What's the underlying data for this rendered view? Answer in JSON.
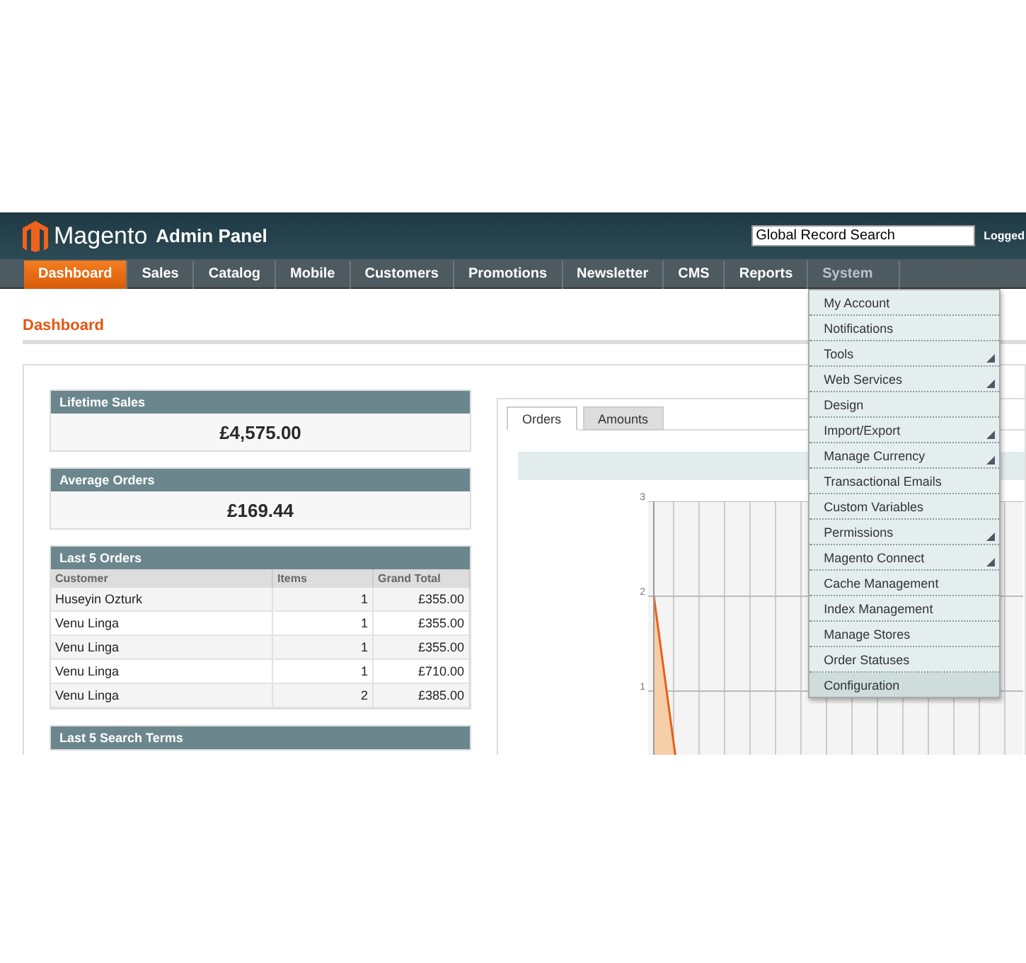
{
  "header": {
    "logo": "Magento",
    "subtitle": "Admin Panel",
    "search": {
      "value": "Global Record Search"
    },
    "user": "Logged"
  },
  "nav": [
    {
      "label": "Dashboard",
      "selected": true,
      "open": false
    },
    {
      "label": "Sales",
      "selected": false,
      "open": false
    },
    {
      "label": "Catalog",
      "selected": false,
      "open": false
    },
    {
      "label": "Mobile",
      "selected": false,
      "open": false
    },
    {
      "label": "Customers",
      "selected": false,
      "open": false
    },
    {
      "label": "Promotions",
      "selected": false,
      "open": false
    },
    {
      "label": "Newsletter",
      "selected": false,
      "open": false
    },
    {
      "label": "CMS",
      "selected": false,
      "open": false
    },
    {
      "label": "Reports",
      "selected": false,
      "open": false
    },
    {
      "label": "System",
      "selected": false,
      "open": true
    }
  ],
  "system_menu": [
    {
      "label": "My Account",
      "has_children": false,
      "selected": false
    },
    {
      "label": "Notifications",
      "has_children": false,
      "selected": false
    },
    {
      "label": "Tools",
      "has_children": true,
      "selected": false
    },
    {
      "label": "Web Services",
      "has_children": true,
      "selected": false
    },
    {
      "label": "Design",
      "has_children": false,
      "selected": false
    },
    {
      "label": "Import/Export",
      "has_children": true,
      "selected": false
    },
    {
      "label": "Manage Currency",
      "has_children": true,
      "selected": false
    },
    {
      "label": "Transactional Emails",
      "has_children": false,
      "selected": false
    },
    {
      "label": "Custom Variables",
      "has_children": false,
      "selected": false
    },
    {
      "label": "Permissions",
      "has_children": true,
      "selected": false
    },
    {
      "label": "Magento Connect",
      "has_children": true,
      "selected": false
    },
    {
      "label": "Cache Management",
      "has_children": false,
      "selected": false
    },
    {
      "label": "Index Management",
      "has_children": false,
      "selected": false
    },
    {
      "label": "Manage Stores",
      "has_children": false,
      "selected": false
    },
    {
      "label": "Order Statuses",
      "has_children": false,
      "selected": false
    },
    {
      "label": "Configuration",
      "has_children": false,
      "selected": true
    }
  ],
  "page_title": "Dashboard",
  "lifetime_sales": {
    "title": "Lifetime Sales",
    "value": "£4,575.00"
  },
  "average_orders": {
    "title": "Average Orders",
    "value": "£169.44"
  },
  "last_orders": {
    "title": "Last 5 Orders",
    "columns": [
      "Customer",
      "Items",
      "Grand Total"
    ],
    "rows": [
      [
        "Huseyin Ozturk",
        "1",
        "£355.00"
      ],
      [
        "Venu Linga",
        "1",
        "£355.00"
      ],
      [
        "Venu Linga",
        "1",
        "£355.00"
      ],
      [
        "Venu Linga",
        "1",
        "£710.00"
      ],
      [
        "Venu Linga",
        "2",
        "£385.00"
      ]
    ]
  },
  "last_search_terms": {
    "title": "Last 5 Search Terms"
  },
  "chart_tabs": [
    {
      "label": "Orders",
      "selected": true
    },
    {
      "label": "Amounts",
      "selected": false
    }
  ],
  "chart_axis_labels": [
    "3",
    "2",
    "1"
  ]
}
